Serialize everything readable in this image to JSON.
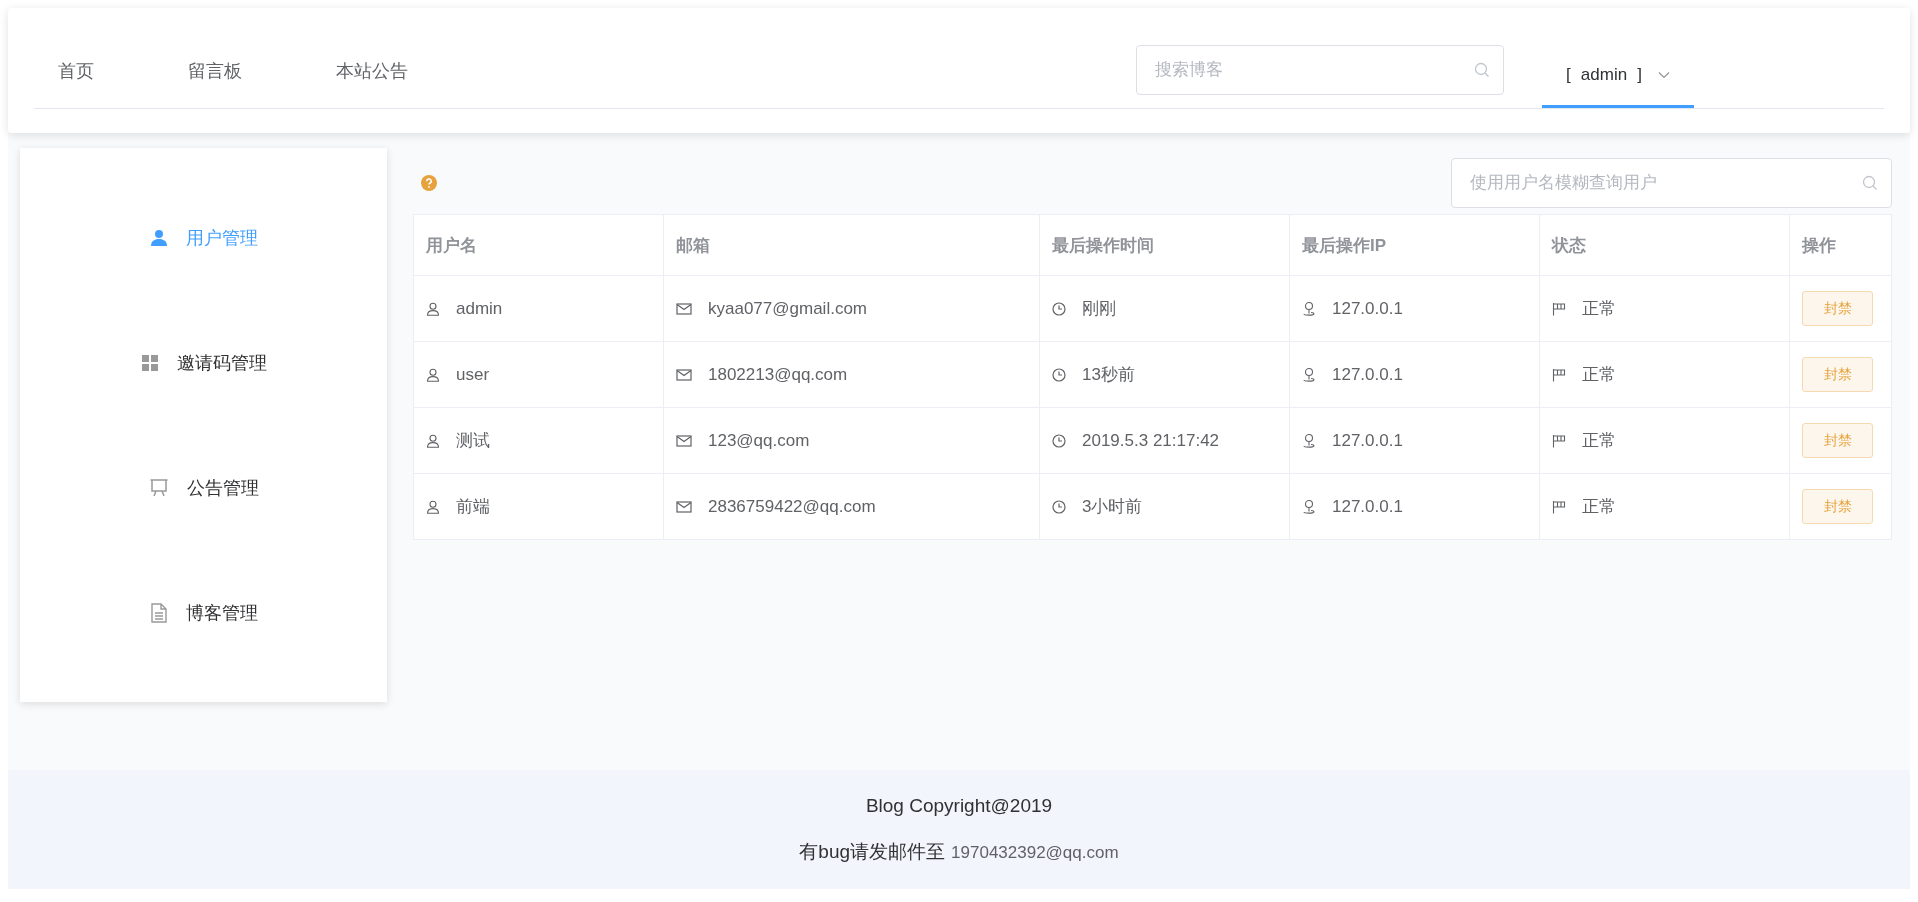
{
  "nav": {
    "links": [
      {
        "label": "首页"
      },
      {
        "label": "留言板"
      },
      {
        "label": "本站公告"
      }
    ],
    "search": {
      "placeholder": "搜索博客"
    },
    "user_menu": {
      "open_bracket": "[",
      "name": "admin",
      "close_bracket": "]",
      "selected": true
    }
  },
  "sidebar": {
    "items": [
      {
        "label": "用户管理",
        "selected": true
      },
      {
        "label": "邀请码管理",
        "selected": false
      },
      {
        "label": "公告管理",
        "selected": false
      },
      {
        "label": "博客管理",
        "selected": false
      }
    ]
  },
  "toolbar": {
    "search": {
      "placeholder": "使用用户名模糊查询用户"
    }
  },
  "table": {
    "columns": [
      "用户名",
      "邮箱",
      "最后操作时间",
      "最后操作IP",
      "状态",
      "操作"
    ],
    "rows": [
      {
        "username": "admin",
        "email": "kyaa077@gmail.com",
        "last_time": "刚刚",
        "last_ip": "127.0.0.1",
        "status": "正常",
        "action": "封禁"
      },
      {
        "username": "user",
        "email": "1802213@qq.com",
        "last_time": "13秒前",
        "last_ip": "127.0.0.1",
        "status": "正常",
        "action": "封禁"
      },
      {
        "username": "测试",
        "email": "123@qq.com",
        "last_time": "2019.5.3 21:17:42",
        "last_ip": "127.0.0.1",
        "status": "正常",
        "action": "封禁"
      },
      {
        "username": "前端",
        "email": "2836759422@qq.com",
        "last_time": "3小时前",
        "last_ip": "127.0.0.1",
        "status": "正常",
        "action": "封禁"
      }
    ]
  },
  "footer": {
    "copyright": "Blog Copyright@2019",
    "bug_text": "有bug请发邮件至",
    "bug_email": "1970432392@qq.com"
  }
}
